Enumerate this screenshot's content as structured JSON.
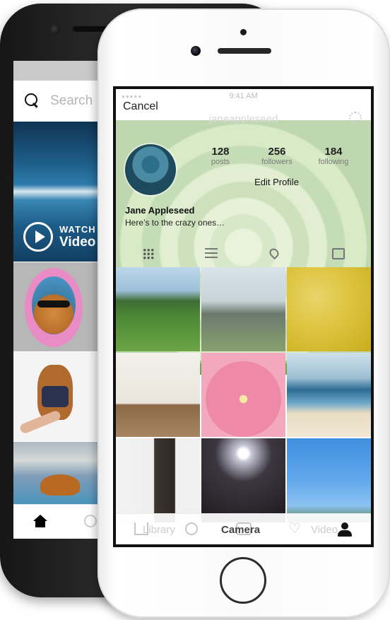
{
  "back_phone": {
    "search_placeholder": "Search",
    "watch_label": "WATCH",
    "watch_sub": "Video"
  },
  "front_phone": {
    "status_time": "9:41 AM",
    "header": {
      "cancel_label": "Cancel",
      "username": "janeappleseed"
    },
    "profile": {
      "stats": [
        {
          "value": "128",
          "label": "posts"
        },
        {
          "value": "256",
          "label": "followers"
        },
        {
          "value": "184",
          "label": "following"
        }
      ],
      "edit_button": "Edit Profile",
      "name": "Jane Appleseed",
      "bio": "Here’s to the crazy ones…"
    },
    "bottom_tabs": {
      "library": "Library",
      "camera": "Camera",
      "video": "Video"
    }
  }
}
